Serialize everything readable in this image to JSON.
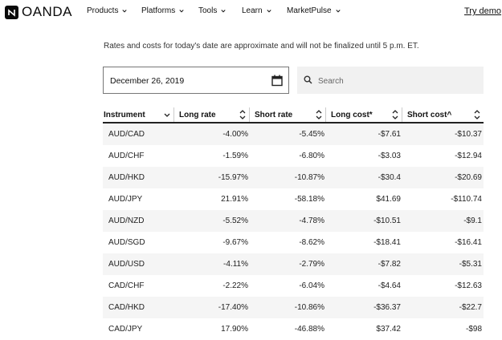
{
  "header": {
    "logo_text": "OANDA",
    "nav": [
      {
        "label": "Products"
      },
      {
        "label": "Platforms"
      },
      {
        "label": "Tools"
      },
      {
        "label": "Learn"
      },
      {
        "label": "MarketPulse"
      }
    ],
    "try_demo": "Try demo"
  },
  "notice": "Rates and costs for today's date are approximate and will not be finalized until 5 p.m. ET.",
  "date_picker": {
    "value": "December 26, 2019"
  },
  "search": {
    "placeholder": "Search"
  },
  "table": {
    "columns": [
      "Instrument",
      "Long rate",
      "Short rate",
      "Long cost*",
      "Short cost^"
    ],
    "rows": [
      [
        "AUD/CAD",
        "-4.00%",
        "-5.45%",
        "-$7.61",
        "-$10.37"
      ],
      [
        "AUD/CHF",
        "-1.59%",
        "-6.80%",
        "-$3.03",
        "-$12.94"
      ],
      [
        "AUD/HKD",
        "-15.97%",
        "-10.87%",
        "-$30.4",
        "-$20.69"
      ],
      [
        "AUD/JPY",
        "21.91%",
        "-58.18%",
        "$41.69",
        "-$110.74"
      ],
      [
        "AUD/NZD",
        "-5.52%",
        "-4.78%",
        "-$10.51",
        "-$9.1"
      ],
      [
        "AUD/SGD",
        "-9.67%",
        "-8.62%",
        "-$18.41",
        "-$16.41"
      ],
      [
        "AUD/USD",
        "-4.11%",
        "-2.79%",
        "-$7.82",
        "-$5.31"
      ],
      [
        "CAD/CHF",
        "-2.22%",
        "-6.04%",
        "-$4.64",
        "-$12.63"
      ],
      [
        "CAD/HKD",
        "-17.40%",
        "-10.86%",
        "-$36.37",
        "-$22.7"
      ],
      [
        "CAD/JPY",
        "17.90%",
        "-46.88%",
        "$37.42",
        "-$98"
      ]
    ]
  }
}
